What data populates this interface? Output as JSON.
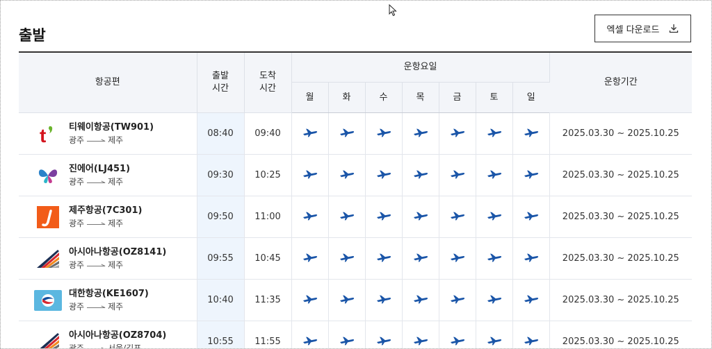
{
  "section": {
    "title": "출발"
  },
  "excel_button": {
    "label": "엑셀 다운로드",
    "icon": "download-icon"
  },
  "headers": {
    "flight": "항공편",
    "dep_line1": "출발",
    "dep_line2": "시간",
    "arr_line1": "도착",
    "arr_line2": "시간",
    "op_days": "운항요일",
    "days": [
      "월",
      "화",
      "수",
      "목",
      "금",
      "토",
      "일"
    ],
    "period": "운항기간"
  },
  "colors": {
    "plane": "#1a55a8",
    "dep_bg": "#eef5fd",
    "header_bg": "#f3f5f9"
  },
  "flights": [
    {
      "name": "티웨이항공(TW901)",
      "from": "광주",
      "to": "제주",
      "dep": "08:40",
      "arr": "09:40",
      "period": "2025.03.30 ~ 2025.10.25",
      "logo": "tway-logo",
      "days": [
        true,
        true,
        true,
        true,
        true,
        true,
        true
      ]
    },
    {
      "name": "진에어(LJ451)",
      "from": "광주",
      "to": "제주",
      "dep": "09:30",
      "arr": "10:25",
      "period": "2025.03.30 ~ 2025.10.25",
      "logo": "jinair-logo",
      "days": [
        true,
        true,
        true,
        true,
        true,
        true,
        true
      ]
    },
    {
      "name": "제주항공(7C301)",
      "from": "광주",
      "to": "제주",
      "dep": "09:50",
      "arr": "11:00",
      "period": "2025.03.30 ~ 2025.10.25",
      "logo": "jejuair-logo",
      "days": [
        true,
        true,
        true,
        true,
        true,
        true,
        true
      ]
    },
    {
      "name": "아시아나항공(OZ8141)",
      "from": "광주",
      "to": "제주",
      "dep": "09:55",
      "arr": "10:45",
      "period": "2025.03.30 ~ 2025.10.25",
      "logo": "asiana-logo",
      "days": [
        true,
        true,
        true,
        true,
        true,
        true,
        true
      ]
    },
    {
      "name": "대한항공(KE1607)",
      "from": "광주",
      "to": "제주",
      "dep": "10:40",
      "arr": "11:35",
      "period": "2025.03.30 ~ 2025.10.25",
      "logo": "koreanair-logo",
      "days": [
        true,
        true,
        true,
        true,
        true,
        true,
        true
      ]
    },
    {
      "name": "아시아나항공(OZ8704)",
      "from": "광주",
      "to": "서울/김포",
      "dep": "10:55",
      "arr": "11:55",
      "period": "2025.03.30 ~ 2025.10.25",
      "logo": "asiana-logo",
      "days": [
        true,
        true,
        true,
        true,
        true,
        true,
        true
      ]
    }
  ]
}
